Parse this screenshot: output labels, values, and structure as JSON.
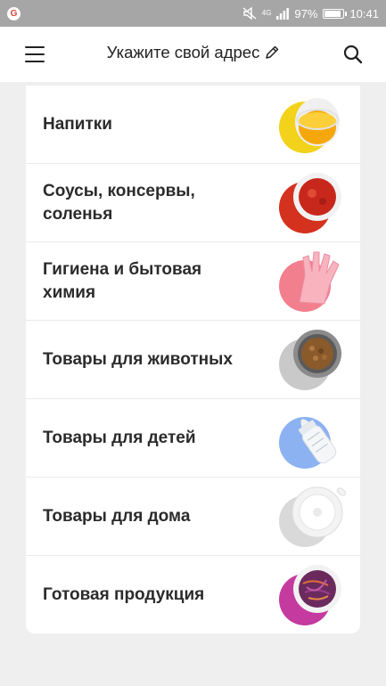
{
  "status_bar": {
    "network_label": "4G",
    "battery_percent": "97%",
    "battery_level": 0.97,
    "time": "10:41"
  },
  "header": {
    "address_label": "Укажите свой адрес"
  },
  "categories": [
    {
      "label": "Напитки",
      "accent": "#f2d21b",
      "icon": "juice-glass-icon"
    },
    {
      "label": "Соусы, консервы, соленья",
      "accent": "#d4311f",
      "icon": "sauce-bowl-icon"
    },
    {
      "label": "Гигиена и бытовая химия",
      "accent": "#f27f8e",
      "icon": "rubber-glove-icon"
    },
    {
      "label": "Товары для животных",
      "accent": "#c9c9c9",
      "icon": "pet-food-bowl-icon"
    },
    {
      "label": "Товары для детей",
      "accent": "#8cb2f2",
      "icon": "baby-bottle-icon"
    },
    {
      "label": "Товары для дома",
      "accent": "#d9d9d9",
      "icon": "white-pot-icon"
    },
    {
      "label": "Готовая продукция",
      "accent": "#c53a9f",
      "icon": "salad-bowl-icon"
    }
  ]
}
